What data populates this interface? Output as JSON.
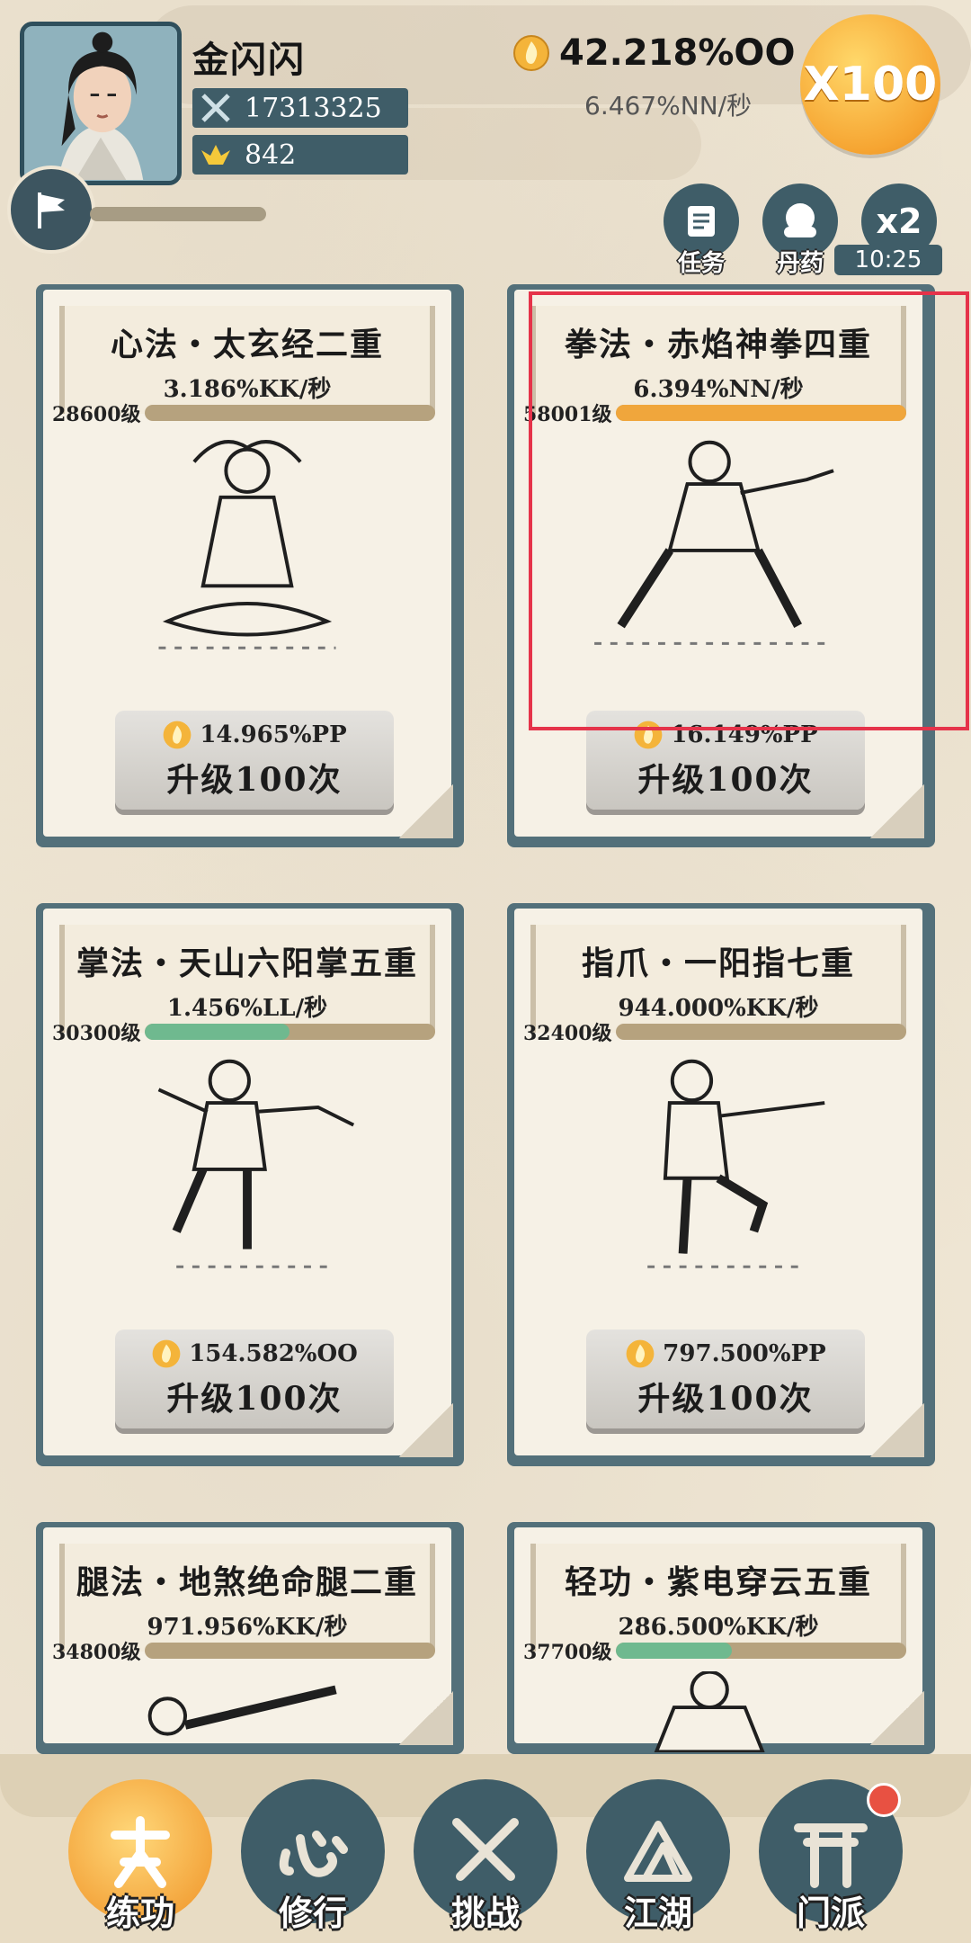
{
  "player": {
    "name": "金闪闪",
    "power": "17313325",
    "ingots": "842"
  },
  "currency": {
    "gold": "42.218%OO",
    "rate": "6.467%NN/秒"
  },
  "multiplier": "X100",
  "quick_buttons": {
    "task_label": "任务",
    "pill_label": "丹药",
    "x2_label": "x2",
    "timer": "10:25"
  },
  "cards": [
    {
      "title": "心法・太玄经二重",
      "rate": "3.186%KK/秒",
      "level": "28600级",
      "progress": 0,
      "cost": "14.965%PP",
      "button": "升级100次"
    },
    {
      "title": "拳法・赤焰神拳四重",
      "rate": "6.394%NN/秒",
      "level": "58001级",
      "progress": 1.0,
      "cost": "16.149%PP",
      "button": "升级100次"
    },
    {
      "title": "掌法・天山六阳掌五重",
      "rate": "1.456%LL/秒",
      "level": "30300级",
      "progress": 0.5,
      "cost": "154.582%OO",
      "button": "升级100次"
    },
    {
      "title": "指爪・一阳指七重",
      "rate": "944.000%KK/秒",
      "level": "32400级",
      "progress": 0,
      "cost": "797.500%PP",
      "button": "升级100次"
    },
    {
      "title": "腿法・地煞绝命腿二重",
      "rate": "971.956%KK/秒",
      "level": "34800级",
      "progress": 0
    },
    {
      "title": "轻功・紫电穿云五重",
      "rate": "286.500%KK/秒",
      "level": "37700级",
      "progress": 0.4
    }
  ],
  "colors": {
    "progress_orange": "#f0a63c",
    "progress_green": "#6fb98f",
    "highlight": "#e5334a"
  },
  "nav": [
    {
      "label": "练功",
      "icon": "kungfu-icon",
      "active": true
    },
    {
      "label": "修行",
      "icon": "heart-mind-icon"
    },
    {
      "label": "挑战",
      "icon": "crossed-swords-icon"
    },
    {
      "label": "江湖",
      "icon": "mountain-icon"
    },
    {
      "label": "门派",
      "icon": "gate-icon",
      "badge": true
    }
  ]
}
